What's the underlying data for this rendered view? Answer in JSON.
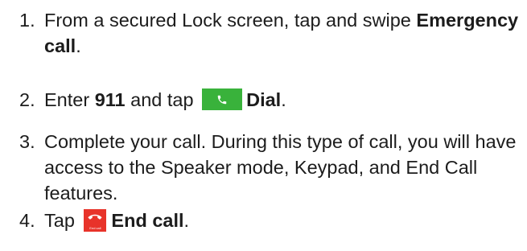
{
  "steps": [
    {
      "number": "1.",
      "text_before": "From a secured Lock screen, tap and swipe ",
      "bold": "Emergency call",
      "text_after": "."
    },
    {
      "number": "2.",
      "text_before": "Enter ",
      "bold_number": "911",
      "text_middle": " and tap ",
      "icon": "phone-icon",
      "bold": "Dial",
      "text_after": "."
    },
    {
      "number": "3.",
      "text": "Complete your call. During this type of call, you will have access to the Speaker mode, Keypad, and End Call features."
    },
    {
      "number": "4.",
      "text_before": "Tap ",
      "icon": "end-call-icon",
      "icon_caption": "End call",
      "bold": "End call",
      "text_after": "."
    }
  ],
  "colors": {
    "dial_button": "#39b23b",
    "end_call_button": "#e8332a",
    "text": "#1c1c1c"
  }
}
